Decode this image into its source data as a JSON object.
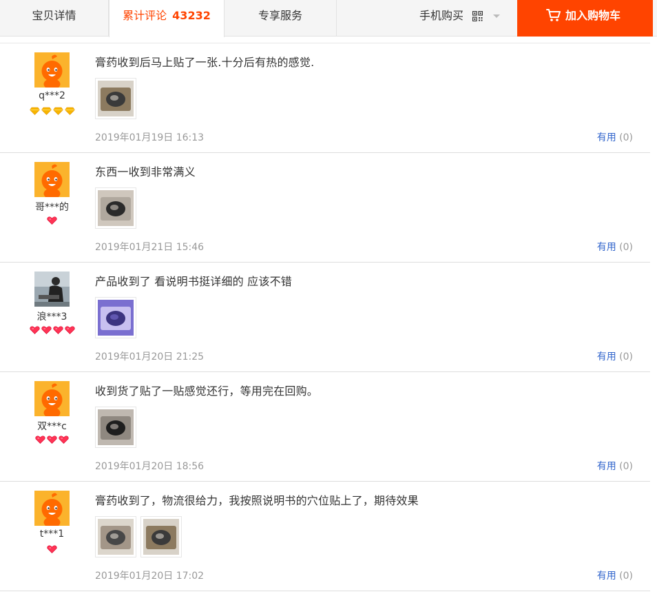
{
  "tabs": {
    "details": "宝贝详情",
    "reviews_label": "累计评论",
    "reviews_count": "43232",
    "service": "专享服务",
    "mobile_buy": "手机购买",
    "add_to_cart": "加入购物车"
  },
  "colors": {
    "accent": "#ff4400",
    "link": "#3366cc"
  },
  "reviews": [
    {
      "user": "q***2",
      "avatar": "orange-mascot",
      "badge_type": "gold-diamond",
      "badge_count": 4,
      "text": "膏药收到后马上贴了一张.十分后有热的感觉.",
      "photos": [
        "photo-1"
      ],
      "date": "2019年01月19日 16:13",
      "useful_label": "有用",
      "useful_count": "(0)"
    },
    {
      "user": "哥***的",
      "avatar": "orange-mascot",
      "badge_type": "red-heart",
      "badge_count": 1,
      "text": "东西一收到非常满义",
      "photos": [
        "photo-1"
      ],
      "date": "2019年01月21日 15:46",
      "useful_label": "有用",
      "useful_count": "(0)"
    },
    {
      "user": "浪***3",
      "avatar": "person-photo",
      "badge_type": "red-heart",
      "badge_count": 4,
      "text": "产品收到了 看说明书挺详细的 应该不错",
      "photos": [
        "photo-1"
      ],
      "date": "2019年01月20日 21:25",
      "useful_label": "有用",
      "useful_count": "(0)"
    },
    {
      "user": "双***c",
      "avatar": "orange-mascot",
      "badge_type": "red-heart",
      "badge_count": 3,
      "text": "收到货了贴了一贴感觉还行，等用完在回购。",
      "photos": [
        "photo-1"
      ],
      "date": "2019年01月20日 18:56",
      "useful_label": "有用",
      "useful_count": "(0)"
    },
    {
      "user": "t***1",
      "avatar": "orange-mascot",
      "badge_type": "red-heart",
      "badge_count": 1,
      "text": "膏药收到了，物流很给力，我按照说明书的穴位贴上了，期待效果",
      "photos": [
        "photo-1",
        "photo-2"
      ],
      "date": "2019年01月20日 17:02",
      "useful_label": "有用",
      "useful_count": "(0)"
    }
  ]
}
